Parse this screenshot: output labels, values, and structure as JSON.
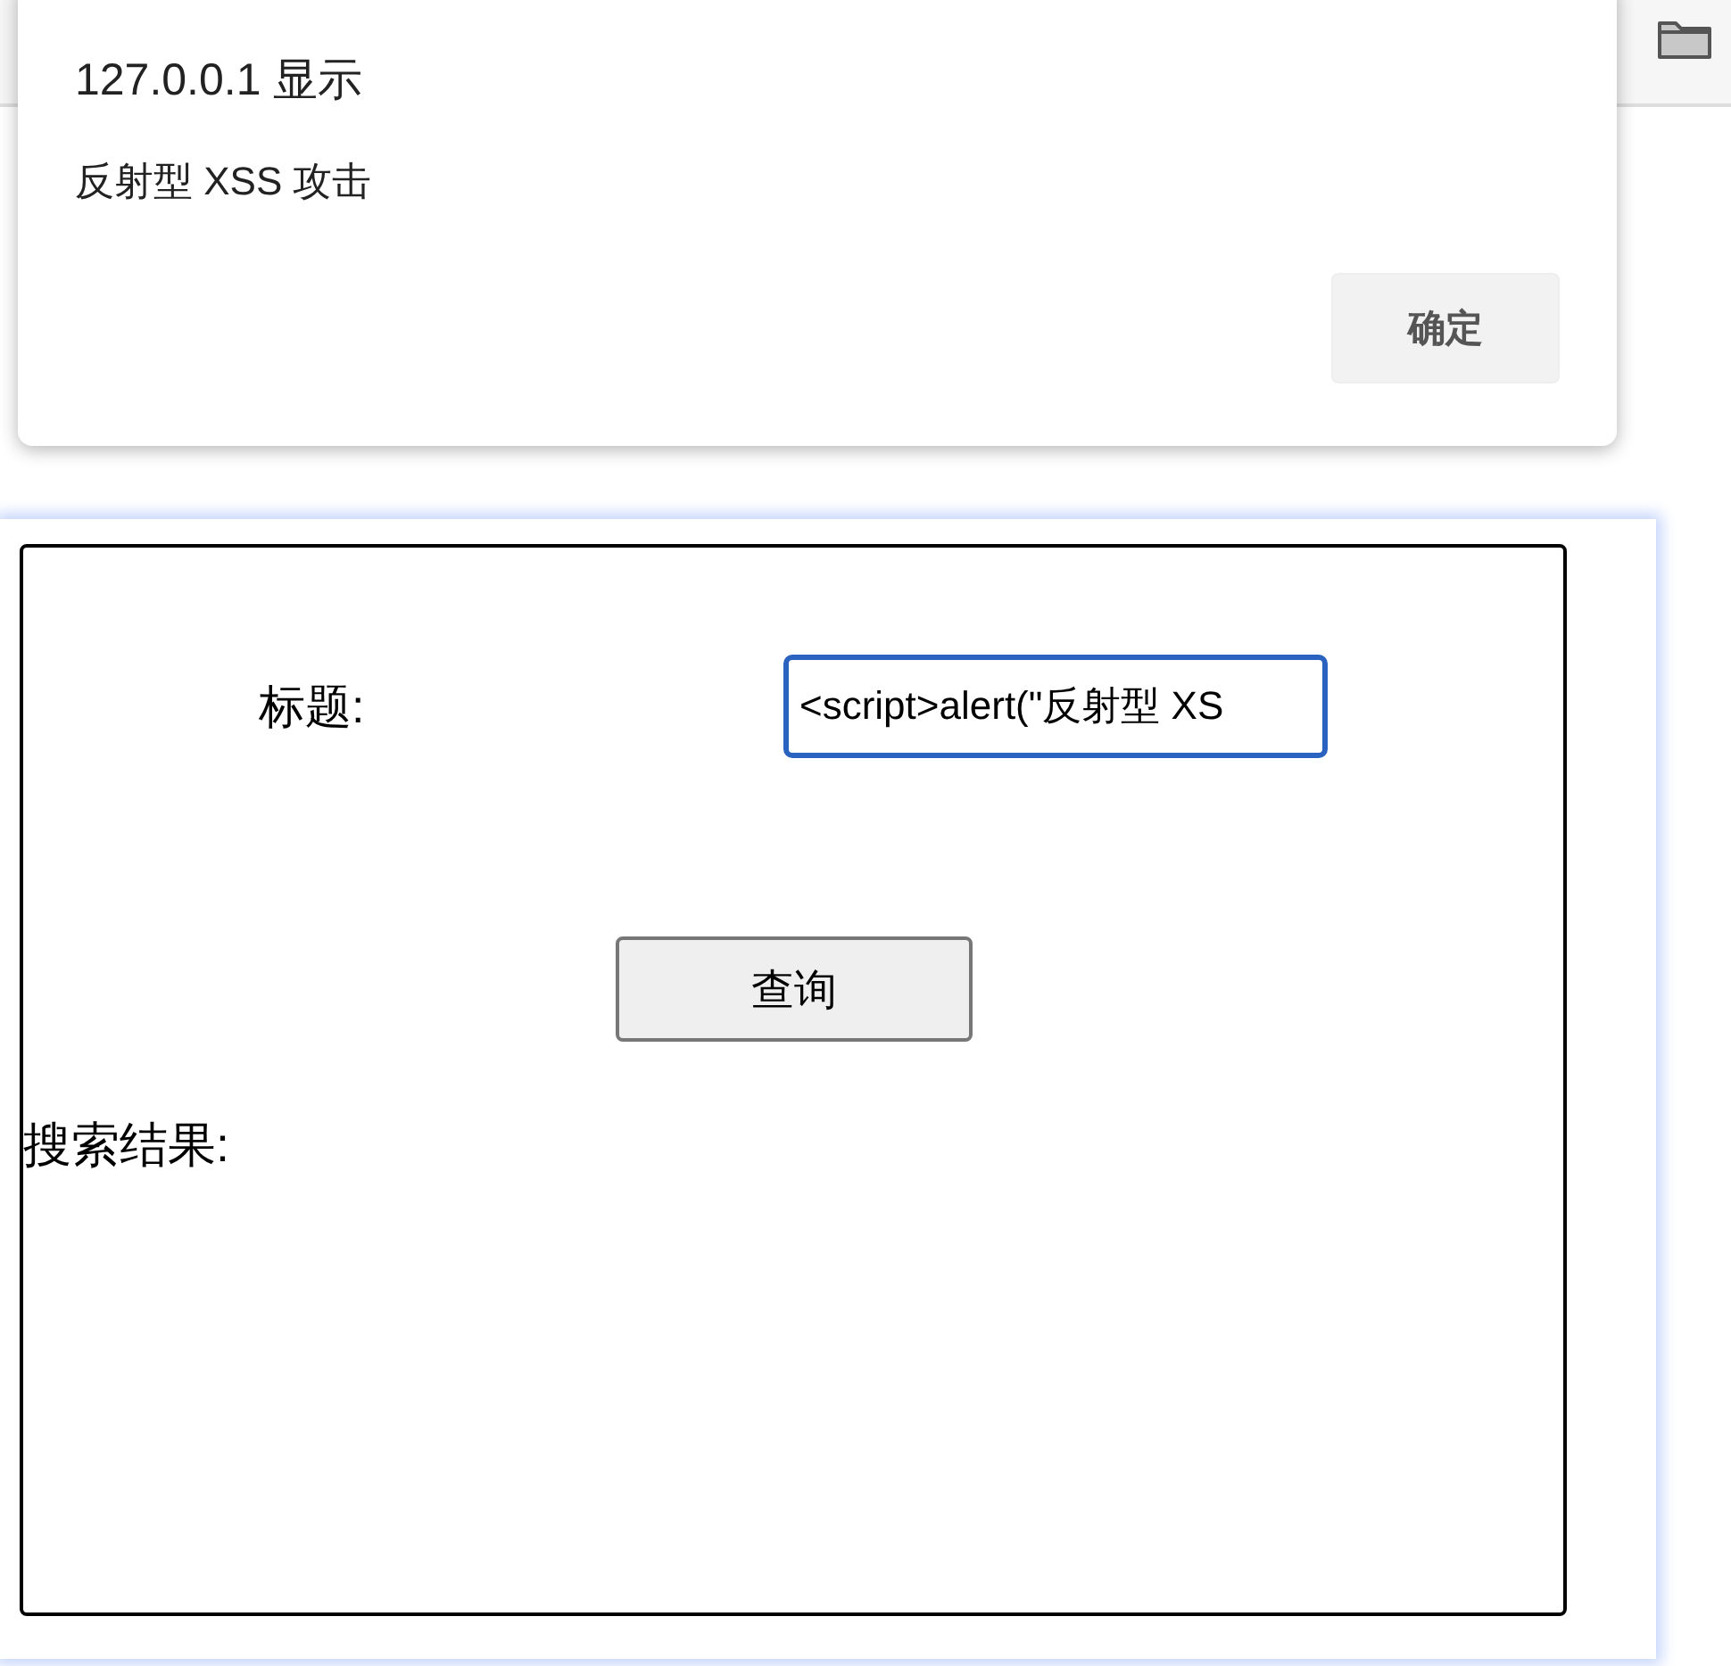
{
  "dialog": {
    "title": "127.0.0.1 显示",
    "message": "反射型 XSS 攻击",
    "ok_button": "确定"
  },
  "form": {
    "title_label": "标题:",
    "title_value": "<script>alert(\"反射型 XS",
    "submit_button": "查询",
    "results_label": "搜索结果:"
  }
}
